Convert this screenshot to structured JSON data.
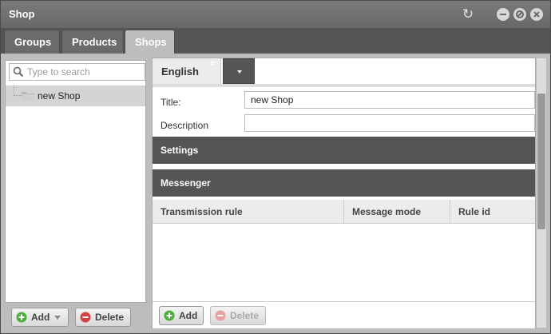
{
  "window": {
    "title": "Shop"
  },
  "tabs": [
    {
      "label": "Groups"
    },
    {
      "label": "Products"
    },
    {
      "label": "Shops"
    }
  ],
  "left_panel": {
    "search_placeholder": "Type to search",
    "tree": [
      {
        "label": "new Shop"
      }
    ],
    "add_label": "Add",
    "delete_label": "Delete"
  },
  "right_panel": {
    "language_tab": "English",
    "language_close": "×",
    "fields": {
      "title_label": "Title:",
      "title_value": "new Shop",
      "description_label": "Description",
      "description_value": ""
    },
    "sections": {
      "settings": "Settings",
      "messenger": "Messenger"
    },
    "grid_columns": [
      "Transmission rule",
      "Message mode",
      "Rule id"
    ],
    "add_label": "Add",
    "delete_label": "Delete"
  },
  "icons": {
    "refresh": "refresh-icon",
    "minimize": "minimize-icon",
    "maximize": "maximize-icon",
    "close": "close-icon"
  },
  "colors": {
    "add_green": "#4caf3a",
    "delete_red": "#d64040"
  }
}
